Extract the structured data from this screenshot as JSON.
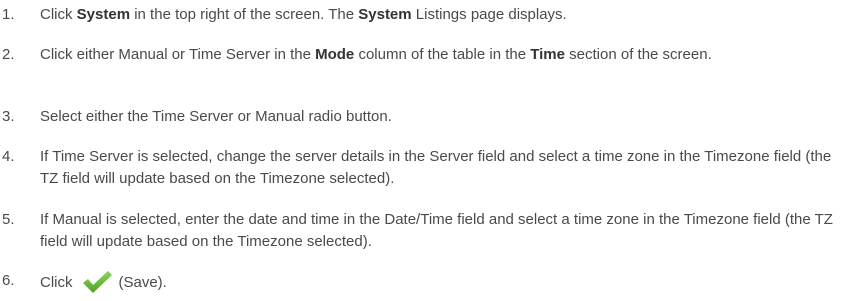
{
  "steps": [
    {
      "num": "1.",
      "parts": [
        "Click ",
        "System",
        " in the top right of the screen. The ",
        "System",
        " Listings page displays."
      ]
    },
    {
      "num": "2.",
      "parts": [
        "Click either Manual or Time Server in the ",
        "Mode",
        " column of the table in the ",
        "Time",
        " section of the screen."
      ]
    },
    {
      "num": "3.",
      "text": "Select either the Time Server or Manual radio button."
    },
    {
      "num": "4.",
      "text": "If Time Server is selected, change the server details in the Server field and select a time zone in the Timezone field (the TZ field will update based on the Timezone selected)."
    },
    {
      "num": "5.",
      "text": "If Manual is selected, enter the date and time in the Date/Time field and select a time zone in the Timezone field (the TZ field will update based on the Timezone selected)."
    },
    {
      "num": "6.",
      "before": "Click",
      "icon": "checkmark-save-icon",
      "after": "(Save).",
      "icon_color": "#5cb82f"
    }
  ]
}
